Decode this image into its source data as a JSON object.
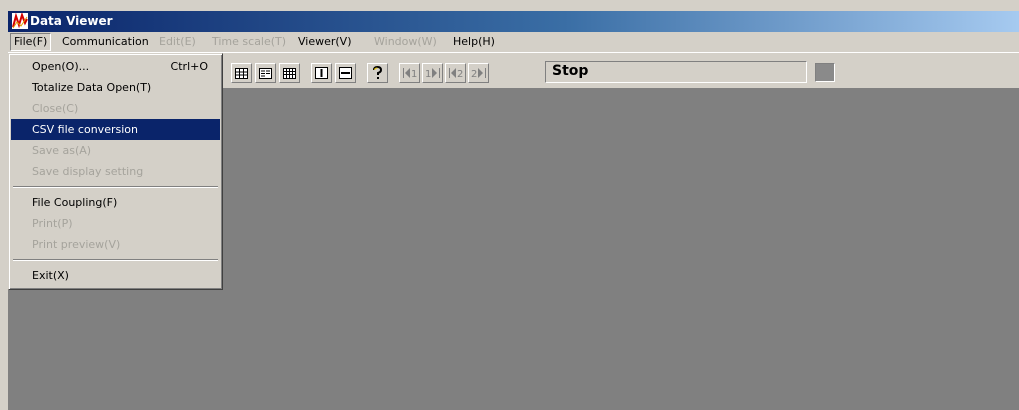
{
  "window": {
    "title": "Data Viewer",
    "icon": "graph-app-icon"
  },
  "menubar": {
    "items": [
      {
        "label": "File(F)",
        "enabled": true,
        "open": true
      },
      {
        "label": "Communication",
        "enabled": true
      },
      {
        "label": "Edit(E)",
        "enabled": false
      },
      {
        "label": "Time scale(T)",
        "enabled": false
      },
      {
        "label": "Viewer(V)",
        "enabled": true
      },
      {
        "label": "Window(W)",
        "enabled": false
      },
      {
        "label": "Help(H)",
        "enabled": true
      }
    ]
  },
  "file_menu": {
    "items": [
      {
        "label": "Open(O)...",
        "shortcut": "Ctrl+O",
        "enabled": true
      },
      {
        "label": "Totalize Data Open(T)",
        "enabled": true
      },
      {
        "label": "Close(C)",
        "enabled": false
      },
      {
        "label": "CSV file conversion",
        "enabled": true,
        "highlighted": true
      },
      {
        "label": "Save as(A)",
        "enabled": false
      },
      {
        "label": "Save display setting",
        "enabled": false
      },
      {
        "label": "File Coupling(F)",
        "enabled": true
      },
      {
        "label": "Print(P)",
        "enabled": false
      },
      {
        "label": "Print preview(V)",
        "enabled": false
      },
      {
        "label": "Exit(X)",
        "enabled": true
      }
    ]
  },
  "toolbar": {
    "buttons": [
      {
        "icon": "table-view-icon"
      },
      {
        "icon": "list-view-icon"
      },
      {
        "icon": "grid-view-icon"
      },
      {
        "icon": "vertical-cursor-icon"
      },
      {
        "icon": "horizontal-cursor-icon"
      },
      {
        "icon": "help-cursor-icon"
      },
      {
        "icon": "cursor1-left-icon",
        "label": "1"
      },
      {
        "icon": "cursor1-right-icon",
        "label": "1"
      },
      {
        "icon": "cursor2-left-icon",
        "label": "2"
      },
      {
        "icon": "cursor2-right-icon",
        "label": "2"
      }
    ],
    "status": "Stop"
  },
  "colors": {
    "title_gradient_start": "#0a246a",
    "title_gradient_end": "#a6caf0",
    "menu_highlight": "#0a246a",
    "workspace": "#808080",
    "chrome": "#d4d0c8"
  }
}
